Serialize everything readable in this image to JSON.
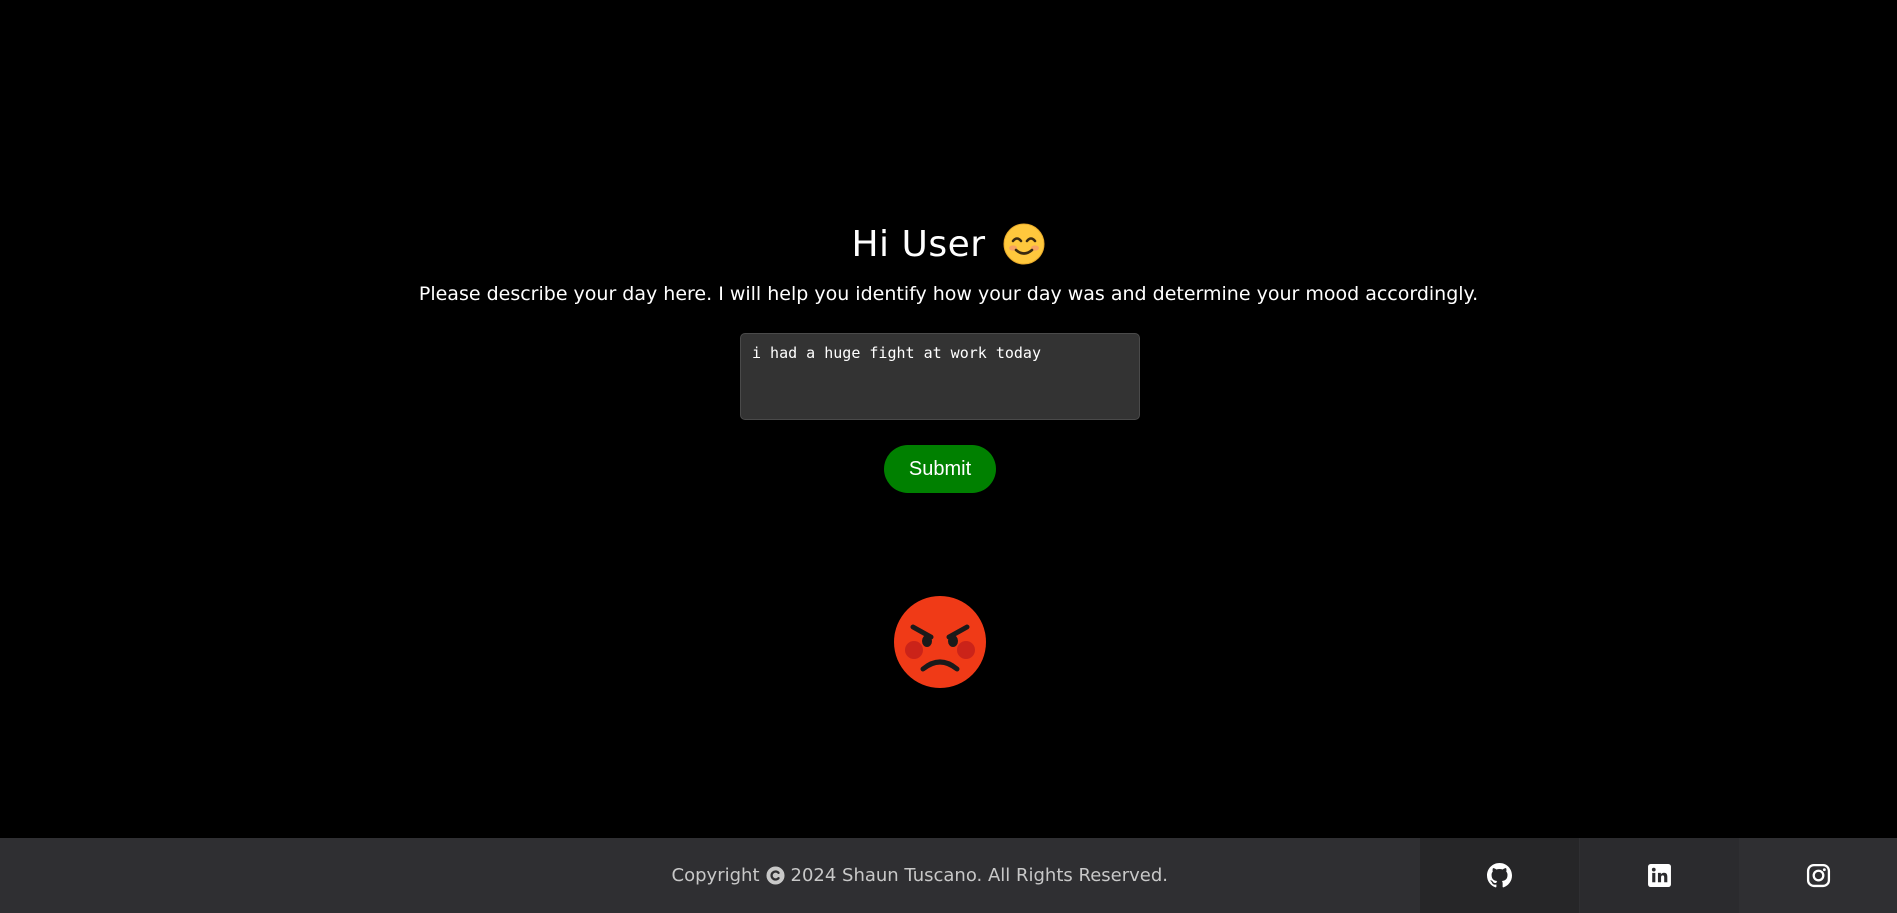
{
  "header": {
    "greeting": "Hi User",
    "greeting_icon": "smiling-face-icon",
    "instruction": "Please describe your day here. I will help you identify how your day was and determine your mood accordingly."
  },
  "form": {
    "textarea_value": "i had a huge fight at work today",
    "submit_label": "Submit"
  },
  "result": {
    "mood_icon": "angry-face-icon"
  },
  "footer": {
    "copyright_prefix": "Copyright",
    "copyright_rest": "2024 Shaun Tuscano. All Rights Reserved.",
    "social_links": [
      "github-icon",
      "linkedin-icon",
      "instagram-icon"
    ]
  },
  "colors": {
    "background": "#000000",
    "submit_button": "#008000",
    "textarea_bg": "#333333",
    "footer_bg": "#2f2f32",
    "angry_face": "#f03a17"
  }
}
